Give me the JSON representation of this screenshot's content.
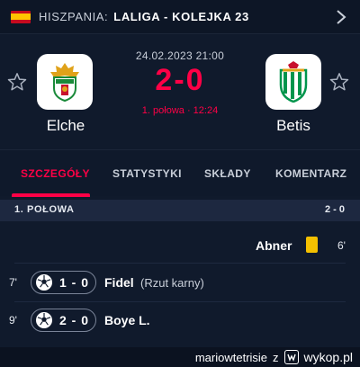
{
  "header": {
    "country": "HISZPANIA:",
    "competition": "LALIGA - KOLEJKA 23",
    "flag_colors": [
      "#c60b1e",
      "#ffc400"
    ]
  },
  "match": {
    "datetime": "24.02.2023 21:00",
    "score": "2-0",
    "status": "1. połowa · 12:24",
    "home_team": "Elche",
    "away_team": "Betis",
    "accent_color": "#ff0046"
  },
  "tabs": [
    {
      "label": "SZCZEGÓŁY",
      "active": true
    },
    {
      "label": "STATYSTYKI",
      "active": false
    },
    {
      "label": "SKŁADY",
      "active": false
    },
    {
      "label": "KOMENTARZ",
      "active": false
    }
  ],
  "section": {
    "title": "1. POŁOWA",
    "score": "2 - 0"
  },
  "events": [
    {
      "minute": "6'",
      "player": "Abner",
      "type": "yellow-card",
      "side": "away"
    },
    {
      "minute": "7'",
      "player": "Fidel",
      "note": "(Rzut karny)",
      "score": "1 - 0",
      "type": "goal",
      "side": "home"
    },
    {
      "minute": "9'",
      "player": "Boye L.",
      "score": "2 - 0",
      "type": "goal",
      "side": "home"
    }
  ],
  "watermark": {
    "user": "mariowtetrisie",
    "sep": "z",
    "site": "wykop.pl"
  }
}
